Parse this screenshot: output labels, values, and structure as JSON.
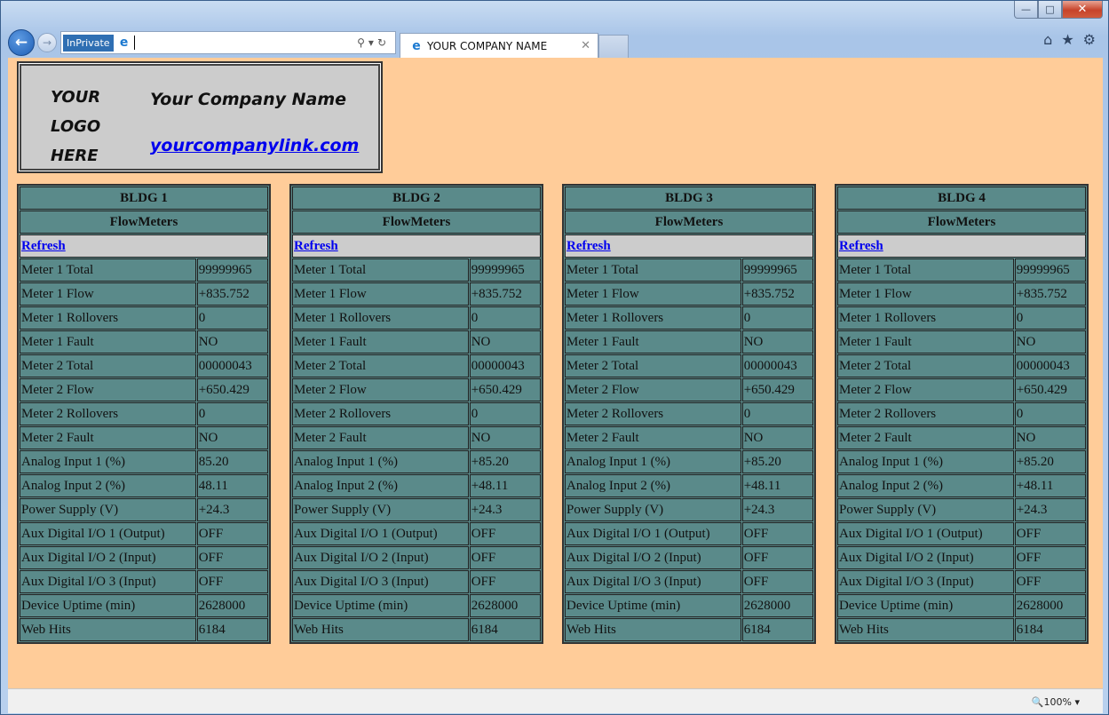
{
  "browser": {
    "inprivate_label": "InPrivate",
    "address_text": "",
    "tab_title": "YOUR COMPANY NAME",
    "zoom": "100%"
  },
  "header": {
    "logo_lines": [
      "YOUR",
      "LOGO",
      "HERE"
    ],
    "company_name": "Your Company Name",
    "company_link": "yourcompanylink.com"
  },
  "buildings": [
    {
      "title": "BLDG 1",
      "subtitle": "FlowMeters",
      "refresh": "Refresh",
      "rows": [
        [
          "Meter 1 Total",
          "99999965"
        ],
        [
          "Meter 1 Flow",
          "+835.752"
        ],
        [
          "Meter 1 Rollovers",
          "0"
        ],
        [
          "Meter 1 Fault",
          "NO"
        ],
        [
          "Meter 2 Total",
          "00000043"
        ],
        [
          "Meter 2 Flow",
          "+650.429"
        ],
        [
          "Meter 2 Rollovers",
          "0"
        ],
        [
          "Meter 2 Fault",
          "NO"
        ],
        [
          "Analog Input 1 (%)",
          "85.20"
        ],
        [
          "Analog Input 2 (%)",
          "48.11"
        ],
        [
          "Power Supply (V)",
          "+24.3"
        ],
        [
          "Aux Digital I/O 1 (Output)",
          "OFF"
        ],
        [
          "Aux Digital I/O 2 (Input)",
          "OFF"
        ],
        [
          "Aux Digital I/O 3 (Input)",
          "OFF"
        ],
        [
          "Device Uptime (min)",
          "2628000"
        ],
        [
          "Web Hits",
          "6184"
        ]
      ]
    },
    {
      "title": "BLDG 2",
      "subtitle": "FlowMeters",
      "refresh": "Refresh",
      "rows": [
        [
          "Meter 1 Total",
          "99999965"
        ],
        [
          "Meter 1 Flow",
          "+835.752"
        ],
        [
          "Meter 1 Rollovers",
          "0"
        ],
        [
          "Meter 1 Fault",
          "NO"
        ],
        [
          "Meter 2 Total",
          "00000043"
        ],
        [
          "Meter 2 Flow",
          "+650.429"
        ],
        [
          "Meter 2 Rollovers",
          "0"
        ],
        [
          "Meter 2 Fault",
          "NO"
        ],
        [
          "Analog Input 1 (%)",
          "+85.20"
        ],
        [
          "Analog Input 2 (%)",
          "+48.11"
        ],
        [
          "Power Supply (V)",
          "+24.3"
        ],
        [
          "Aux Digital I/O 1 (Output)",
          "OFF"
        ],
        [
          "Aux Digital I/O 2 (Input)",
          "OFF"
        ],
        [
          "Aux Digital I/O 3 (Input)",
          "OFF"
        ],
        [
          "Device Uptime (min)",
          "2628000"
        ],
        [
          "Web Hits",
          "6184"
        ]
      ]
    },
    {
      "title": "BLDG 3",
      "subtitle": "FlowMeters",
      "refresh": "Refresh",
      "rows": [
        [
          "Meter 1 Total",
          "99999965"
        ],
        [
          "Meter 1 Flow",
          "+835.752"
        ],
        [
          "Meter 1 Rollovers",
          "0"
        ],
        [
          "Meter 1 Fault",
          "NO"
        ],
        [
          "Meter 2 Total",
          "00000043"
        ],
        [
          "Meter 2 Flow",
          "+650.429"
        ],
        [
          "Meter 2 Rollovers",
          "0"
        ],
        [
          "Meter 2 Fault",
          "NO"
        ],
        [
          "Analog Input 1 (%)",
          "+85.20"
        ],
        [
          "Analog Input 2 (%)",
          "+48.11"
        ],
        [
          "Power Supply (V)",
          "+24.3"
        ],
        [
          "Aux Digital I/O 1 (Output)",
          "OFF"
        ],
        [
          "Aux Digital I/O 2 (Input)",
          "OFF"
        ],
        [
          "Aux Digital I/O 3 (Input)",
          "OFF"
        ],
        [
          "Device Uptime (min)",
          "2628000"
        ],
        [
          "Web Hits",
          "6184"
        ]
      ]
    },
    {
      "title": "BLDG 4",
      "subtitle": "FlowMeters",
      "refresh": "Refresh",
      "rows": [
        [
          "Meter 1 Total",
          "99999965"
        ],
        [
          "Meter 1 Flow",
          "+835.752"
        ],
        [
          "Meter 1 Rollovers",
          "0"
        ],
        [
          "Meter 1 Fault",
          "NO"
        ],
        [
          "Meter 2 Total",
          "00000043"
        ],
        [
          "Meter 2 Flow",
          "+650.429"
        ],
        [
          "Meter 2 Rollovers",
          "0"
        ],
        [
          "Meter 2 Fault",
          "NO"
        ],
        [
          "Analog Input 1 (%)",
          "+85.20"
        ],
        [
          "Analog Input 2 (%)",
          "+48.11"
        ],
        [
          "Power Supply (V)",
          "+24.3"
        ],
        [
          "Aux Digital I/O 1 (Output)",
          "OFF"
        ],
        [
          "Aux Digital I/O 2 (Input)",
          "OFF"
        ],
        [
          "Aux Digital I/O 3 (Input)",
          "OFF"
        ],
        [
          "Device Uptime (min)",
          "2628000"
        ],
        [
          "Web Hits",
          "6184"
        ]
      ]
    }
  ],
  "colors": {
    "page_background": "#ffcc99",
    "table_background": "#5a8a8a",
    "refresh_row": "#cccccc",
    "link": "#0000ee"
  }
}
